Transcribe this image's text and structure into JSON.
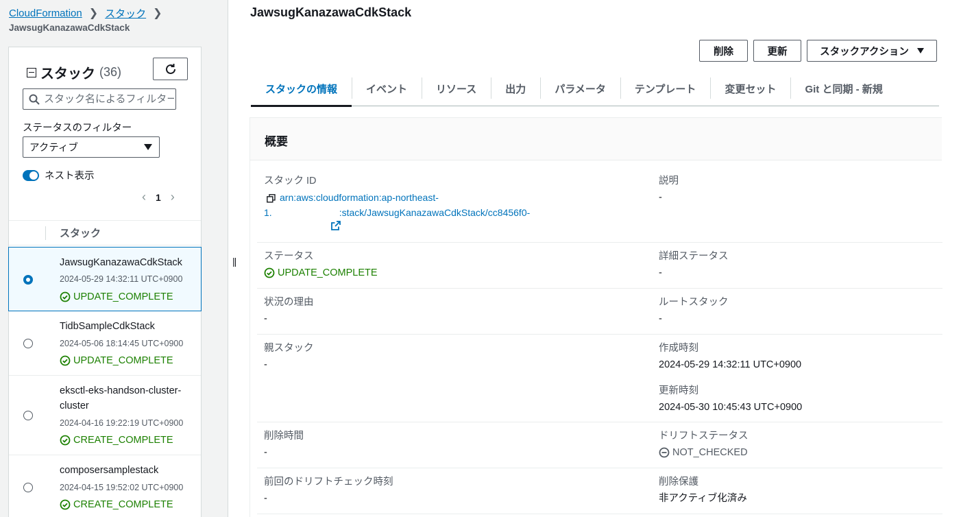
{
  "breadcrumb": {
    "items": [
      "CloudFormation",
      "スタック"
    ],
    "current": "JawsugKanazawaCdkStack"
  },
  "sidebar": {
    "title": "スタック",
    "count": "(36)",
    "search_placeholder": "スタック名によるフィルター",
    "status_filter_label": "ステータスのフィルター",
    "status_filter_value": "アクティブ",
    "nested_toggle_label": "ネスト表示",
    "page": "1",
    "list_header": "スタック",
    "stacks": [
      {
        "name": "JawsugKanazawaCdkStack",
        "date": "2024-05-29 14:32:11 UTC+0900",
        "status": "UPDATE_COMPLETE",
        "selected": true
      },
      {
        "name": "TidbSampleCdkStack",
        "date": "2024-05-06 18:14:45 UTC+0900",
        "status": "UPDATE_COMPLETE",
        "selected": false
      },
      {
        "name": "eksctl-eks-handson-cluster-cluster",
        "date": "2024-04-16 19:22:19 UTC+0900",
        "status": "CREATE_COMPLETE",
        "selected": false
      },
      {
        "name": "composersamplestack",
        "date": "2024-04-15 19:52:02 UTC+0900",
        "status": "CREATE_COMPLETE",
        "selected": false
      }
    ]
  },
  "main": {
    "title": "JawsugKanazawaCdkStack",
    "buttons": {
      "delete": "削除",
      "update": "更新",
      "stack_actions": "スタックアクション"
    },
    "tabs": [
      "スタックの情報",
      "イベント",
      "リソース",
      "出力",
      "パラメータ",
      "テンプレート",
      "変更セット",
      "Git と同期 - 新規"
    ],
    "active_tab": "スタックの情報",
    "overview": {
      "title": "概要",
      "stack_id_label": "スタック ID",
      "stack_id_line1": "arn:aws:cloudformation:ap-northeast-",
      "stack_id_line2a": "1.",
      "stack_id_line2b": ":stack/JawsugKanazawaCdkStack/cc8456f0-",
      "description_label": "説明",
      "description_value": "-",
      "status_label": "ステータス",
      "status_value": "UPDATE_COMPLETE",
      "detailed_status_label": "詳細ステータス",
      "detailed_status_value": "-",
      "reason_label": "状況の理由",
      "reason_value": "-",
      "root_stack_label": "ルートスタック",
      "root_stack_value": "-",
      "parent_stack_label": "親スタック",
      "parent_stack_value": "-",
      "created_label": "作成時刻",
      "created_value": "2024-05-29 14:32:11 UTC+0900",
      "updated_label": "更新時刻",
      "updated_value": "2024-05-30 10:45:43 UTC+0900",
      "deleted_label": "削除時間",
      "deleted_value": "-",
      "drift_status_label": "ドリフトステータス",
      "drift_status_value": "NOT_CHECKED",
      "last_drift_label": "前回のドリフトチェック時刻",
      "last_drift_value": "-",
      "termination_label": "削除保護",
      "termination_value": "非アクティブ化済み"
    }
  },
  "colors": {
    "link": "#0073bb",
    "success": "#1d8102",
    "text": "#16191f",
    "muted": "#545b64"
  }
}
